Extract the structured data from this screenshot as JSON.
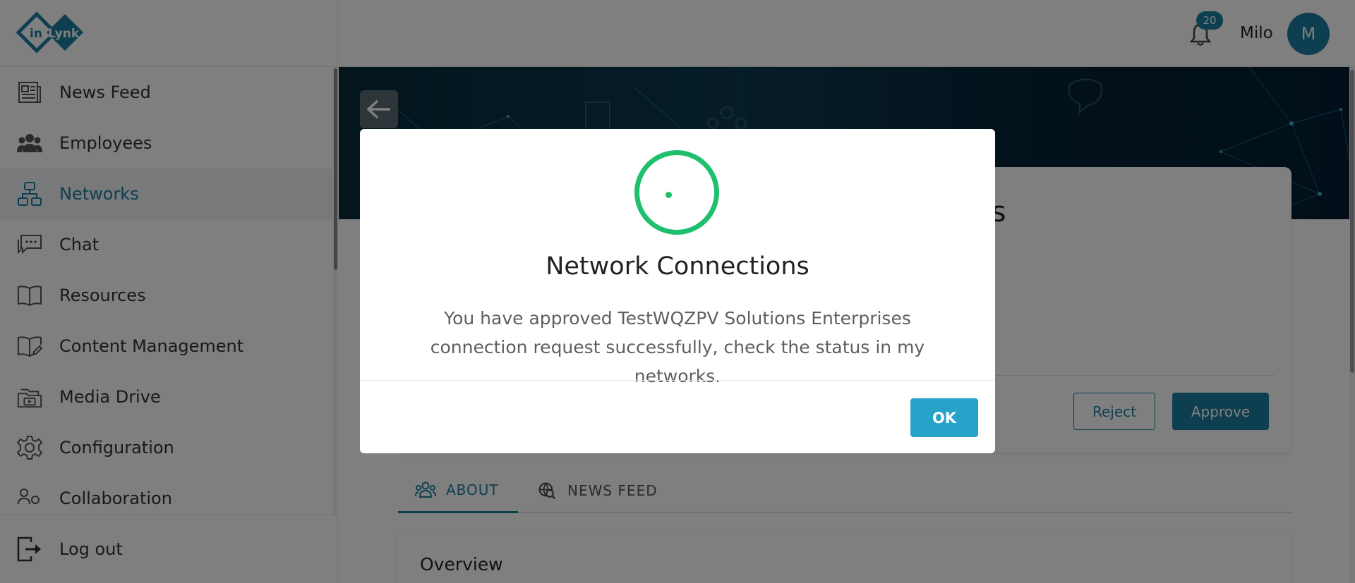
{
  "app": {
    "logo_text_in": "in",
    "logo_text_lynk": "Lynk",
    "brand_color": "#1d7fa1"
  },
  "sidebar": {
    "items": [
      {
        "label": "News Feed",
        "icon": "newspaper-icon"
      },
      {
        "label": "Employees",
        "icon": "people-icon"
      },
      {
        "label": "Networks",
        "icon": "network-icon",
        "active": true
      },
      {
        "label": "Chat",
        "icon": "chat-icon"
      },
      {
        "label": "Resources",
        "icon": "book-icon"
      },
      {
        "label": "Content Management",
        "icon": "book-edit-icon"
      },
      {
        "label": "Media Drive",
        "icon": "media-folder-icon"
      },
      {
        "label": "Configuration",
        "icon": "gear-icon"
      },
      {
        "label": "Collaboration",
        "icon": "collaboration-icon"
      }
    ],
    "logout_label": "Log out"
  },
  "header": {
    "notification_count": "20",
    "username": "Milo",
    "avatar_initial": "M"
  },
  "profile": {
    "title_fragment": "es",
    "reject_label": "Reject",
    "approve_label": "Approve"
  },
  "tabs": [
    {
      "label": "ABOUT",
      "active": true
    },
    {
      "label": "NEWS FEED",
      "active": false
    }
  ],
  "overview": {
    "title": "Overview"
  },
  "modal": {
    "title": "Network Connections",
    "message": "You have approved TestWQZPV Solutions Enterprises connection request successfully, check the status in my networks.",
    "ok_label": "OK",
    "success_color": "#1fc06d"
  }
}
